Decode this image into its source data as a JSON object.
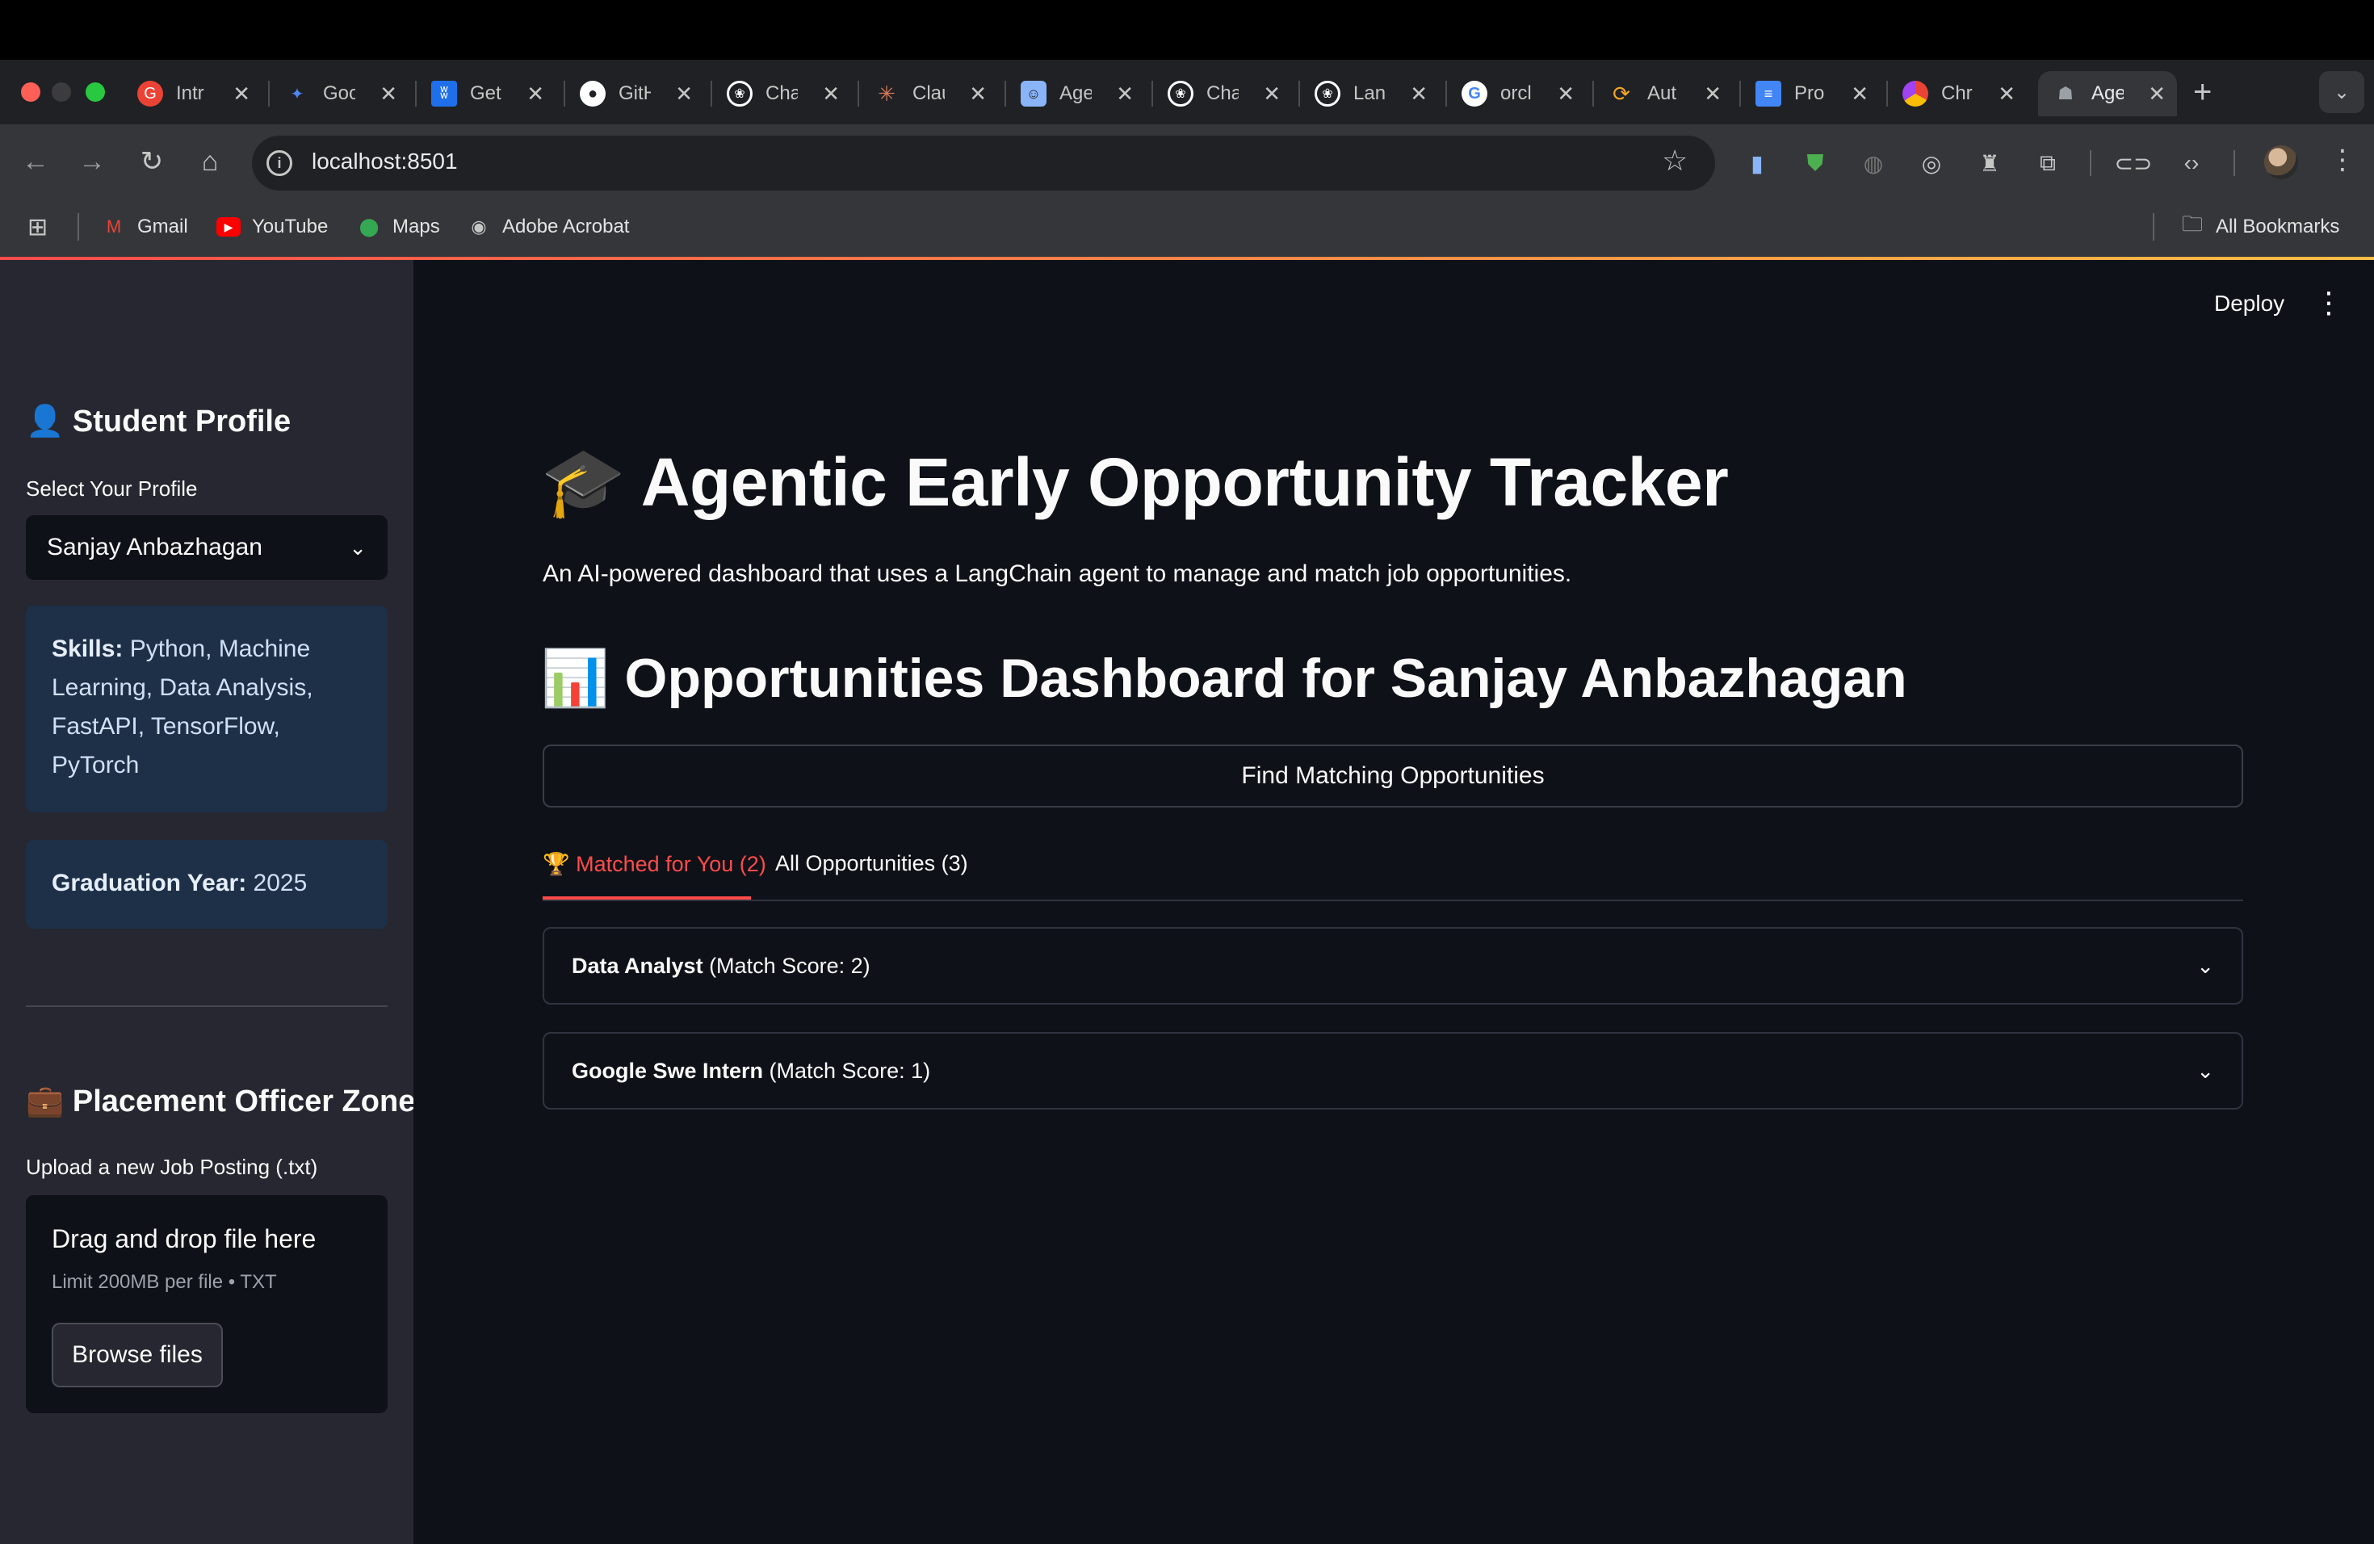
{
  "browser": {
    "tabs": [
      {
        "title": "Intr",
        "icon": "google-color-icon",
        "color": "#ea4335"
      },
      {
        "title": "Goo",
        "icon": "gemini-sparkle-icon",
        "color": "#4e86f5"
      },
      {
        "title": "Get",
        "icon": "butterfly-icon",
        "color": "#1f6feb"
      },
      {
        "title": "GitH",
        "icon": "github-icon",
        "color": "#ffffff"
      },
      {
        "title": "Cha",
        "icon": "openai-icon",
        "color": "#ffffff"
      },
      {
        "title": "Clau",
        "icon": "claude-icon",
        "color": "#d97757"
      },
      {
        "title": "Age",
        "icon": "robot-icon",
        "color": "#8ab4f8"
      },
      {
        "title": "Cha",
        "icon": "openai-icon",
        "color": "#ffffff"
      },
      {
        "title": "Lan",
        "icon": "openai-icon",
        "color": "#ffffff"
      },
      {
        "title": "orcl",
        "icon": "google-icon",
        "color": "#4285f4"
      },
      {
        "title": "Aut",
        "icon": "automation-icon",
        "color": "#f5a623"
      },
      {
        "title": "Pro",
        "icon": "docs-icon",
        "color": "#4285f4"
      },
      {
        "title": "Chr",
        "icon": "chrome-color-icon",
        "color": "#a142f4"
      },
      {
        "title": "Age",
        "icon": "streamlit-robot-icon",
        "color": "#9aa0a6"
      }
    ],
    "new_tab_label": "+",
    "address": "localhost:8501",
    "bookmarks": [
      {
        "label": "Gmail",
        "icon": "gmail-icon"
      },
      {
        "label": "YouTube",
        "icon": "youtube-icon"
      },
      {
        "label": "Maps",
        "icon": "maps-pin-icon"
      },
      {
        "label": "Adobe Acrobat",
        "icon": "globe-icon"
      }
    ],
    "all_bookmarks_label": "All Bookmarks"
  },
  "sidebar": {
    "student_heading": "👤 Student Profile",
    "select_label": "Select Your Profile",
    "selected_profile": "Sanjay Anbazhagan",
    "skills_label": "Skills:",
    "skills_value": " Python, Machine Learning, Data Analysis, FastAPI, TensorFlow, PyTorch",
    "grad_label": "Graduation Year:",
    "grad_value": " 2025",
    "officer_heading": "💼 Placement Officer Zone",
    "upload_label": "Upload a new Job Posting (.txt)",
    "dropzone_title": "Drag and drop file here",
    "dropzone_limit": "Limit 200MB per file • TXT",
    "browse_label": "Browse files"
  },
  "header": {
    "deploy_label": "Deploy"
  },
  "main": {
    "title": "🎓 Agentic Early Opportunity Tracker",
    "description": "An AI-powered dashboard that uses a LangChain agent to manage and match job opportunities.",
    "dashboard_heading": "📊 Opportunities Dashboard for Sanjay Anbazhagan",
    "find_button": "Find Matching Opportunities",
    "tabs": [
      {
        "label": "🏆 Matched for You (2)"
      },
      {
        "label": "All Opportunities (3)"
      }
    ],
    "matches": [
      {
        "title": "Data Analyst",
        "score_text": " (Match Score: 2)"
      },
      {
        "title": "Google Swe Intern",
        "score_text": " (Match Score: 1)"
      }
    ]
  },
  "colors": {
    "accent": "#ff4b4b",
    "sidebar_bg": "#262730",
    "main_bg": "#0e1117",
    "info_box": "#1e3048"
  }
}
